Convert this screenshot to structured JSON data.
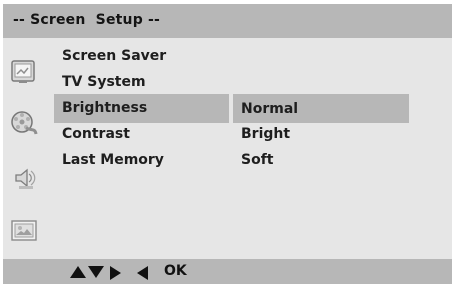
{
  "window": {
    "title": "-- Screen  Setup --"
  },
  "menu": {
    "items": [
      "Screen Saver",
      "TV System",
      "Brightness",
      "Contrast",
      "Last Memory"
    ],
    "selected_index": 2
  },
  "options": {
    "items": [
      "Normal",
      "Bright",
      "Soft"
    ],
    "selected_index": 0
  },
  "footer": {
    "ok_label": "OK"
  },
  "icons": [
    "monitor-icon",
    "film-reel-icon",
    "speaker-icon",
    "picture-icon"
  ]
}
